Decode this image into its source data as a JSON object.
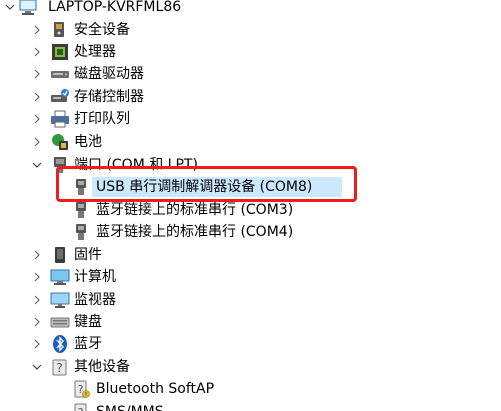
{
  "root": {
    "label": "LAPTOP-KVRFML86",
    "icon": "computer-icon"
  },
  "items": [
    {
      "label": "安全设备",
      "icon": "security-device-icon",
      "state": "collapsed"
    },
    {
      "label": "处理器",
      "icon": "processor-icon",
      "state": "collapsed"
    },
    {
      "label": "磁盘驱动器",
      "icon": "disk-drive-icon",
      "state": "collapsed"
    },
    {
      "label": "存储控制器",
      "icon": "storage-controller-icon",
      "state": "collapsed"
    },
    {
      "label": "打印队列",
      "icon": "printer-icon",
      "state": "collapsed"
    },
    {
      "label": "电池",
      "icon": "battery-icon",
      "state": "collapsed"
    },
    {
      "label": "端口 (COM 和 LPT)",
      "icon": "port-icon",
      "state": "expanded"
    },
    {
      "label": "USB 串行调制解调器设备 (COM8)",
      "icon": "port-icon",
      "state": "child"
    },
    {
      "label": "蓝牙链接上的标准串行 (COM3)",
      "icon": "port-icon",
      "state": "child"
    },
    {
      "label": "蓝牙链接上的标准串行 (COM4)",
      "icon": "port-icon",
      "state": "child"
    },
    {
      "label": "固件",
      "icon": "firmware-icon",
      "state": "collapsed"
    },
    {
      "label": "计算机",
      "icon": "computer-icon",
      "state": "collapsed"
    },
    {
      "label": "监视器",
      "icon": "monitor-icon",
      "state": "collapsed"
    },
    {
      "label": "键盘",
      "icon": "keyboard-icon",
      "state": "collapsed"
    },
    {
      "label": "蓝牙",
      "icon": "bluetooth-icon",
      "state": "collapsed"
    },
    {
      "label": "其他设备",
      "icon": "other-device-icon",
      "state": "expanded"
    },
    {
      "label": "Bluetooth SoftAP",
      "icon": "unknown-device-icon",
      "state": "child"
    },
    {
      "label": "SMS/MMS",
      "icon": "unknown-device-icon",
      "state": "child"
    }
  ],
  "colors": {
    "selection": "#cce8ff",
    "highlight_box": "#ee1c1c"
  }
}
